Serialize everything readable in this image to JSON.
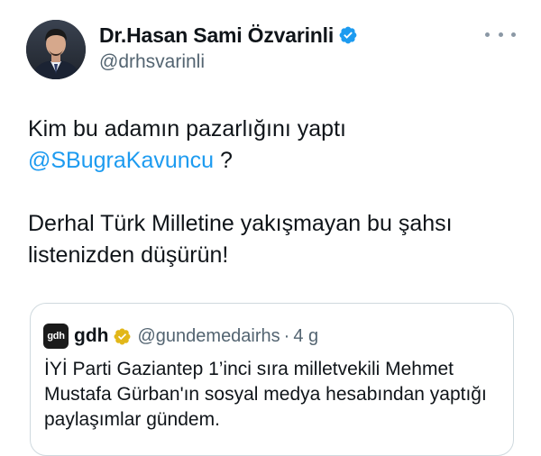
{
  "author": {
    "display_name": "Dr.Hasan Sami Özvarinli",
    "handle": "@drhsvarinli",
    "verified_icon": "verified-badge-icon",
    "badge_color": "#1d9bf0"
  },
  "more_icon": "more-options-icon",
  "tweet": {
    "line1": "Kim bu adamın pazarlığını yaptı",
    "mention": "@SBugraKavuncu",
    "mention_suffix": " ?",
    "line3": "Derhal Türk Milletine yakışmayan bu şahsı",
    "line4": "listenizden düşürün!"
  },
  "quoted_tweet": {
    "logo_text": "gdh",
    "name": "gdh",
    "badge_icon": "gold-verified-badge-icon",
    "badge_color": "#e2b719",
    "handle": "@gundemedairhs",
    "separator": "·",
    "time": "4 g",
    "text": "İYİ Parti Gaziantep 1’inci sıra milletvekili Mehmet Mustafa Gürban'ın sosyal medya hesabından yaptığı paylaşımlar gündem."
  },
  "colors": {
    "text": "#0f1419",
    "secondary": "#536471",
    "link": "#1d9bf0",
    "border": "#cfd9de"
  }
}
